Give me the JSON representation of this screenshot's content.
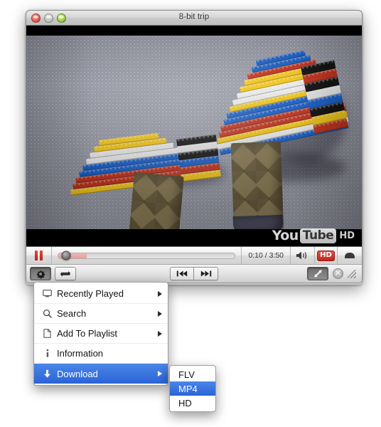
{
  "window": {
    "title": "8-bit trip",
    "traffic_lights": [
      {
        "name": "close-button",
        "color": "#ef6a5e"
      },
      {
        "name": "minimize-button",
        "color": "#f2c14a"
      },
      {
        "name": "zoom-button",
        "color": "#a5dd56"
      }
    ]
  },
  "video": {
    "watermark": {
      "you": "You",
      "tube": "Tube",
      "hd": "HD"
    }
  },
  "controls": {
    "pause_label": "",
    "time_display": "0:10 / 3:50",
    "current_time": "0:10",
    "duration": "3:50",
    "hd_badge": "HD",
    "volume_icon": "speaker-icon",
    "eject_icon": "eject-icon",
    "progress_percent": 4.5,
    "buffer_percent": 16
  },
  "toolbar": {
    "gear_icon": "gear-icon",
    "loop_icon": "loop-icon",
    "prev_icon": "previous-track-icon",
    "next_icon": "next-track-icon",
    "resize_icon": "resize-diagonal-icon",
    "close_label": "✕"
  },
  "menu": {
    "items": [
      {
        "label": "Recently Played",
        "icon": "monitor-icon",
        "has_submenu": true,
        "selected": false
      },
      {
        "label": "Search",
        "icon": "search-icon",
        "has_submenu": true,
        "selected": false
      },
      {
        "label": "Add To Playlist",
        "icon": "document-icon",
        "has_submenu": true,
        "selected": false
      },
      {
        "label": "Information",
        "icon": "info-icon",
        "has_submenu": false,
        "selected": false
      },
      {
        "label": "Download",
        "icon": "download-icon",
        "has_submenu": true,
        "selected": true
      }
    ],
    "highlight_color": "#2a64d6"
  },
  "submenu": {
    "items": [
      {
        "label": "FLV",
        "selected": false
      },
      {
        "label": "MP4",
        "selected": true
      },
      {
        "label": "HD",
        "selected": false
      }
    ]
  }
}
